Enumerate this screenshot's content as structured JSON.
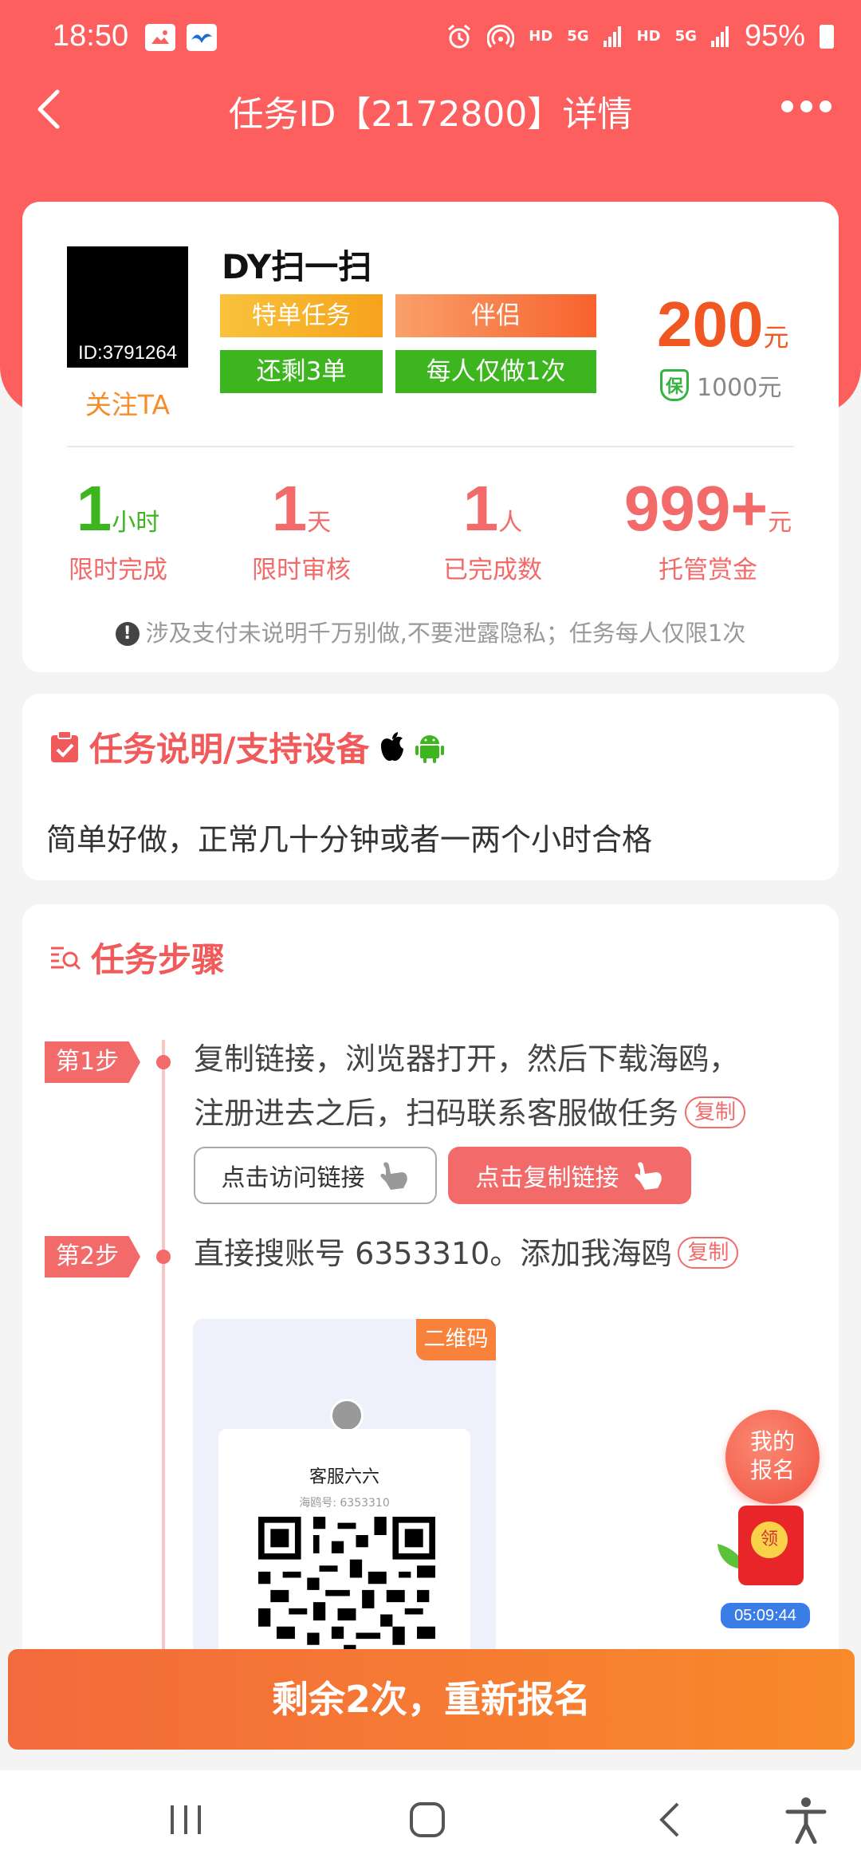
{
  "status_bar": {
    "time": "18:50",
    "battery": "95%",
    "net1": "HD",
    "net2": "5G",
    "net3": "HD",
    "net4": "5G"
  },
  "nav": {
    "title": "任务ID【2172800】详情"
  },
  "task": {
    "publisher_id": "ID:3791264",
    "follow_label": "关注TA",
    "name": "DY扫一扫",
    "tags": [
      "特单任务",
      "伴侣",
      "还剩3单",
      "每人仅做1次"
    ],
    "price": "200",
    "price_unit": "元",
    "guarantee_icon": "保",
    "guarantee": "1000元"
  },
  "stats": [
    {
      "value": "1",
      "unit": "小时",
      "label": "限时完成"
    },
    {
      "value": "1",
      "unit": "天",
      "label": "限时审核"
    },
    {
      "value": "1",
      "unit": "人",
      "label": "已完成数"
    },
    {
      "value": "999+",
      "unit": "元",
      "label": "托管赏金"
    }
  ],
  "notice": "涉及支付未说明千万别做,不要泄露隐私；任务每人仅限1次",
  "description": {
    "title": "任务说明/支持设备",
    "text": "简单好做，正常几十分钟或者一两个小时合格"
  },
  "steps": {
    "title": "任务步骤",
    "copy_label": "复制",
    "items": [
      {
        "badge": "第1步",
        "line1": "复制链接，浏览器打开，然后下载海鸥，",
        "line2": "注册进去之后，扫码联系客服做任务",
        "visit_button": "点击访问链接",
        "copy_button": "点击复制链接"
      },
      {
        "badge": "第2步",
        "line1": "直接搜账号 6353310。添加我海鸥"
      }
    ],
    "qr": {
      "tag": "二维码",
      "name": "客服六六",
      "account": "海鸥号: 6353310"
    }
  },
  "floating": {
    "signup_line1": "我的",
    "signup_line2": "报名",
    "redpack_label": "领",
    "timer": "05:09:44"
  },
  "bottom_button": "剩余2次，重新报名",
  "colors": {
    "header_red": "#fd5f5f",
    "accent_red": "#f36a6a",
    "green": "#3db51f",
    "price_orange": "#f15722"
  }
}
